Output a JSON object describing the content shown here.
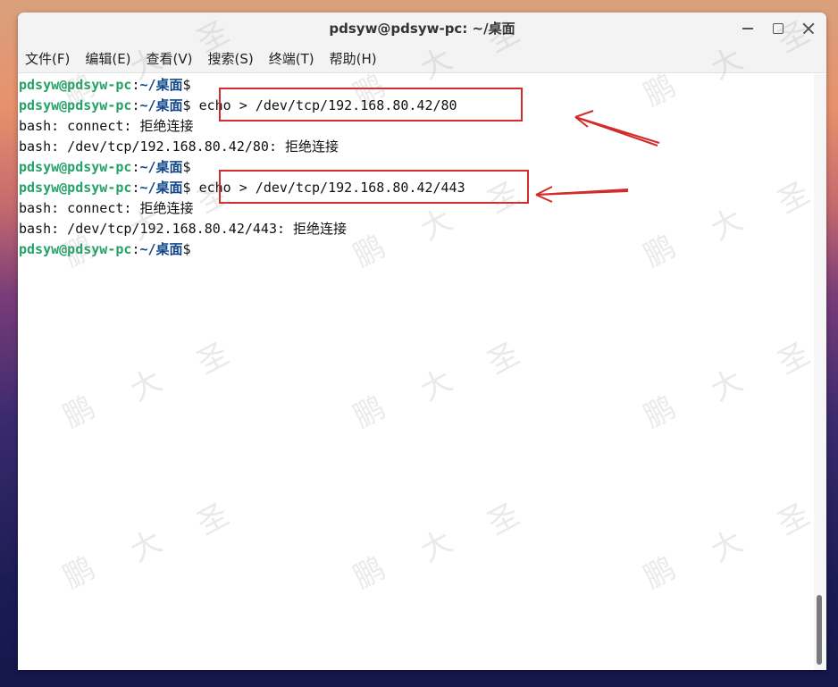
{
  "window": {
    "title": "pdsyw@pdsyw-pc: ~/桌面",
    "controls": [
      "minimize-icon",
      "maximize-icon",
      "close-icon"
    ]
  },
  "menu": [
    "文件(F)",
    "编辑(E)",
    "查看(V)",
    "搜索(S)",
    "终端(T)",
    "帮助(H)"
  ],
  "prompt": {
    "user_host": "pdsyw@pdsyw-pc",
    "sep": ":",
    "path": "~/桌面",
    "symbol": "$"
  },
  "terminal_lines": [
    {
      "type": "prompt",
      "command": ""
    },
    {
      "type": "prompt",
      "command": "echo > /dev/tcp/192.168.80.42/80"
    },
    {
      "type": "output",
      "text": "bash: connect: 拒绝连接"
    },
    {
      "type": "output",
      "text": "bash: /dev/tcp/192.168.80.42/80: 拒绝连接"
    },
    {
      "type": "prompt",
      "command": ""
    },
    {
      "type": "prompt",
      "command": "echo > /dev/tcp/192.168.80.42/443"
    },
    {
      "type": "output",
      "text": "bash: connect: 拒绝连接"
    },
    {
      "type": "output",
      "text": "bash: /dev/tcp/192.168.80.42/443: 拒绝连接"
    },
    {
      "type": "prompt",
      "command": ""
    }
  ],
  "watermark": [
    "鹏",
    "大",
    "圣"
  ],
  "colors": {
    "prompt_user": "#26a269",
    "prompt_path": "#12488b",
    "highlight": "#d22b2b"
  }
}
